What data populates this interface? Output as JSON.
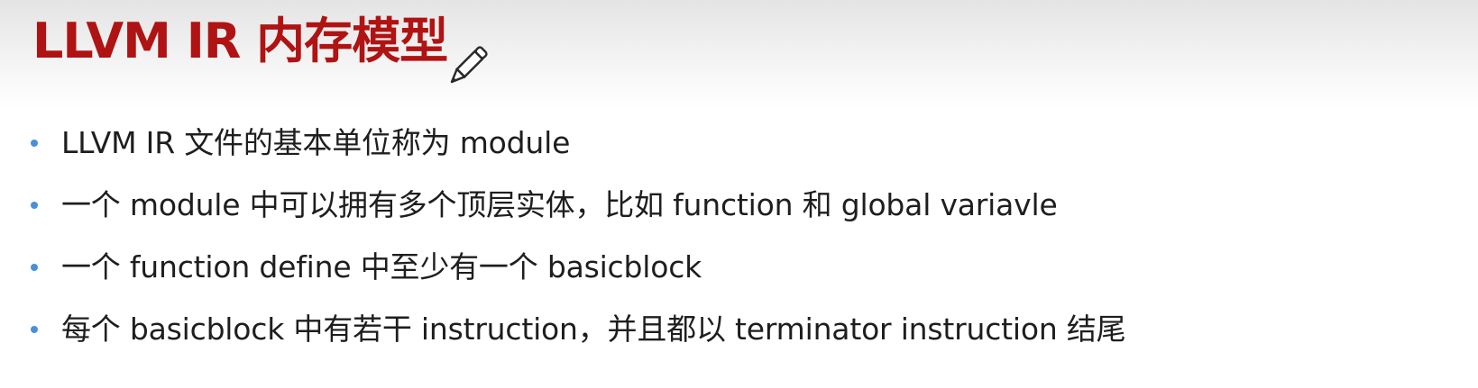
{
  "slide": {
    "title": "LLVM IR 内存模型",
    "pencil_icon": "pencil-icon",
    "accent_color": "#b01313",
    "bullet_color": "#4a90d9",
    "bullets": [
      {
        "text": "LLVM IR 文件的基本单位称为 module"
      },
      {
        "text": "一个 module 中可以拥有多个顶层实体，比如 function 和 global variavle"
      },
      {
        "text": "一个 function define 中至少有一个 basicblock"
      },
      {
        "text": "每个 basicblock 中有若干 instruction，并且都以 terminator instruction 结尾"
      }
    ]
  }
}
